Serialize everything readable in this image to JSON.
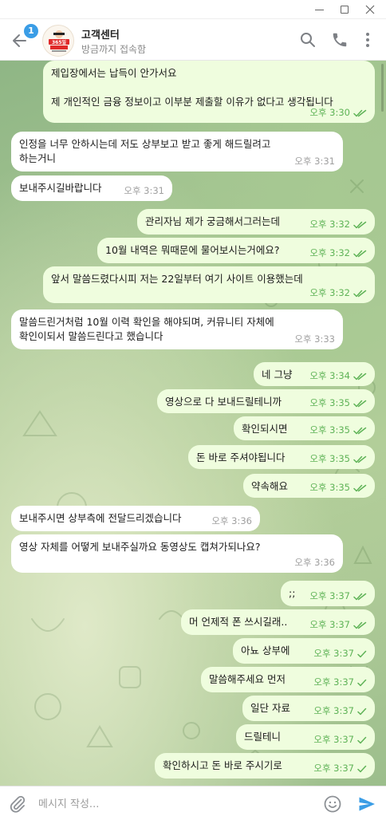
{
  "window": {
    "controls": [
      "minimize",
      "maximize",
      "close"
    ]
  },
  "header": {
    "unread_count": "1",
    "title": "고객센터",
    "status": "방금까지 접속함",
    "avatar_text": "365일 친절상담",
    "icons": [
      "search-icon",
      "phone-icon",
      "more-icon"
    ]
  },
  "messages": [
    {
      "dir": "out",
      "text": "제입장에서는 납득이 안가서요\n\n제 개인적인 금융 정보이고 이부분 제출할 이유가 없다고 생각됩니다",
      "time": "오후 3:30",
      "status": "read"
    },
    {
      "dir": "in",
      "text": "인정을 너무 안하시는데 저도 상부보고 받고 좋게 해드릴려고\n하는거니",
      "time": "오후 3:31"
    },
    {
      "dir": "in",
      "text": "보내주시길바랍니다",
      "time": "오후 3:31"
    },
    {
      "dir": "out",
      "text": "관리자님 제가 궁금해서그러는데",
      "time": "오후 3:32",
      "status": "read"
    },
    {
      "dir": "out",
      "text": "10월 내역은 뭐때문에 물어보시는거에요?",
      "time": "오후 3:32",
      "status": "read"
    },
    {
      "dir": "out",
      "text": "앞서 말씀드렸다시피 저는 22일부터 여기 사이트 이용했는데",
      "time": "오후 3:32",
      "status": "read"
    },
    {
      "dir": "in",
      "text": "말씀드린거처럼 10월 이력 확인을 해야되며, 커뮤니티 자체에\n확인이되서 말씀드린다고 했습니다",
      "time": "오후 3:33"
    },
    {
      "dir": "out",
      "text": "네 그냥",
      "time": "오후 3:34",
      "status": "read"
    },
    {
      "dir": "out",
      "text": "영상으로 다 보내드릴테니까",
      "time": "오후 3:35",
      "status": "read"
    },
    {
      "dir": "out",
      "text": "확인되시면",
      "time": "오후 3:35",
      "status": "read"
    },
    {
      "dir": "out",
      "text": "돈 바로 주셔야됩니다",
      "time": "오후 3:35",
      "status": "read"
    },
    {
      "dir": "out",
      "text": "약속해요",
      "time": "오후 3:35",
      "status": "read"
    },
    {
      "dir": "in",
      "text": "보내주시면 상부측에 전달드리겠습니다",
      "time": "오후 3:36"
    },
    {
      "dir": "in",
      "text": "영상 자체를 어떻게 보내주실까요 동영상도 캡쳐가되나요?",
      "time": "오후 3:36"
    },
    {
      "dir": "out",
      "text": ";;",
      "time": "오후 3:37",
      "status": "read"
    },
    {
      "dir": "out",
      "text": "머 언제적 폰 쓰시길래..",
      "time": "오후 3:37",
      "status": "read"
    },
    {
      "dir": "out",
      "text": "아뇨 상부에",
      "time": "오후 3:37",
      "status": "sent"
    },
    {
      "dir": "out",
      "text": "말씀해주세요 먼저",
      "time": "오후 3:37",
      "status": "sent"
    },
    {
      "dir": "out",
      "text": "일단 자료",
      "time": "오후 3:37",
      "status": "sent"
    },
    {
      "dir": "out",
      "text": "드릴테니",
      "time": "오후 3:37",
      "status": "sent"
    },
    {
      "dir": "out",
      "text": "확인하시고 돈 바로 주시기로",
      "time": "오후 3:37",
      "status": "sent"
    }
  ],
  "composer": {
    "placeholder": "메시지 작성...",
    "value": "",
    "icons": [
      "attach-icon",
      "emoji-icon",
      "send-icon"
    ]
  },
  "colors": {
    "incoming_bubble": "#ffffff",
    "outgoing_bubble": "#effdde",
    "tick_color": "#5fb357",
    "badge": "#3a9de6",
    "send": "#3a9de6"
  }
}
